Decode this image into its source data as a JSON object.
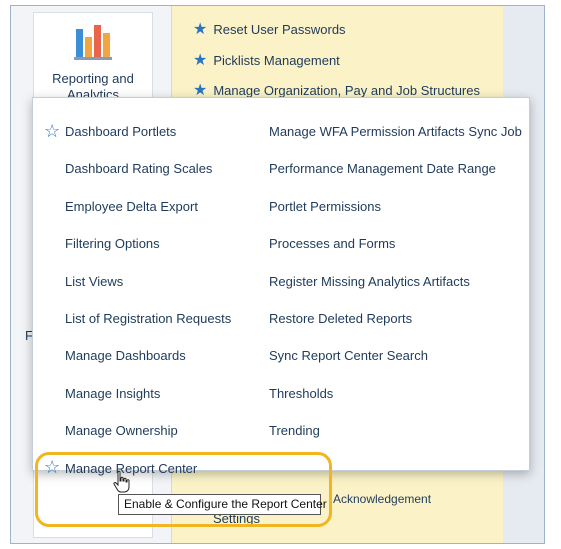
{
  "tile": {
    "label": "Reporting and\nAnalytics"
  },
  "left_letter": "F",
  "favorites": [
    {
      "label": "Reset User Passwords",
      "icon": "star-icon"
    },
    {
      "label": "Picklists Management",
      "icon": "star-icon"
    },
    {
      "label": "Manage Organization, Pay and Job Structures",
      "icon": "star-icon"
    }
  ],
  "background_bits": {
    "settings": "Settings",
    "acknowledgement": "Acknowledgement"
  },
  "menu": {
    "left": [
      "Dashboard Portlets",
      "Dashboard Rating Scales",
      "Employee Delta Export",
      "Filtering Options",
      "List Views",
      "List of Registration Requests",
      "Manage Dashboards",
      "Manage Insights",
      "Manage Ownership",
      "Manage Report Center"
    ],
    "right": [
      "Manage WFA Permission Artifacts Sync Job",
      "Performance Management Date Range",
      "Portlet Permissions",
      "Processes and Forms",
      "Register Missing Analytics Artifacts",
      "Restore Deleted Reports",
      "Sync Report Center Search",
      "Thresholds",
      "Trending"
    ]
  },
  "tooltip": "Enable & Configure the Report Center",
  "colors": {
    "accent": "#2a74c4",
    "highlight": "#f0b521",
    "panel": "#fbf3c7"
  }
}
